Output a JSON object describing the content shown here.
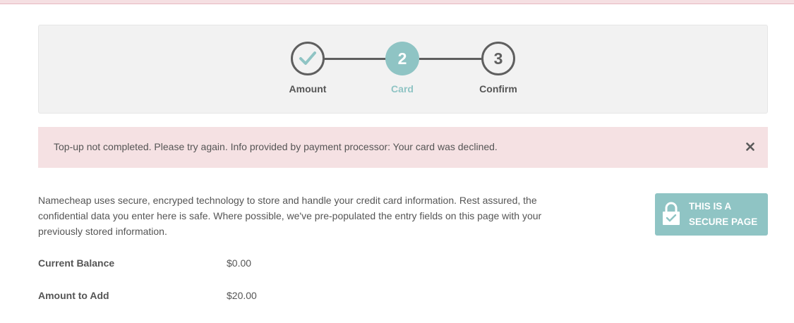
{
  "stepper": {
    "steps": [
      {
        "label": "Amount",
        "state": "done",
        "number": ""
      },
      {
        "label": "Card",
        "state": "active",
        "number": "2"
      },
      {
        "label": "Confirm",
        "state": "pending",
        "number": "3"
      }
    ]
  },
  "alert": {
    "message": "Top-up not completed. Please try again. Info provided by payment processor: Your card was declined.",
    "close_icon": "close-icon"
  },
  "description": "Namecheap uses secure, encryped technology to store and handle your credit card information. Rest assured, the confidential data you enter here is safe. Where possible, we've pre-populated the entry fields on this page with your previously stored information.",
  "secure_badge": {
    "line1": "THIS IS A",
    "line2": "SECURE PAGE",
    "icon": "secure-lock-icon"
  },
  "balance": {
    "current_label": "Current Balance",
    "current_value": "$0.00",
    "add_label": "Amount to Add",
    "add_value": "$20.00"
  },
  "colors": {
    "accent": "#8fc4c4",
    "step_dark": "#5f5f5f",
    "alert_bg": "#f5e1e3",
    "panel_bg": "#f2f2f2"
  }
}
